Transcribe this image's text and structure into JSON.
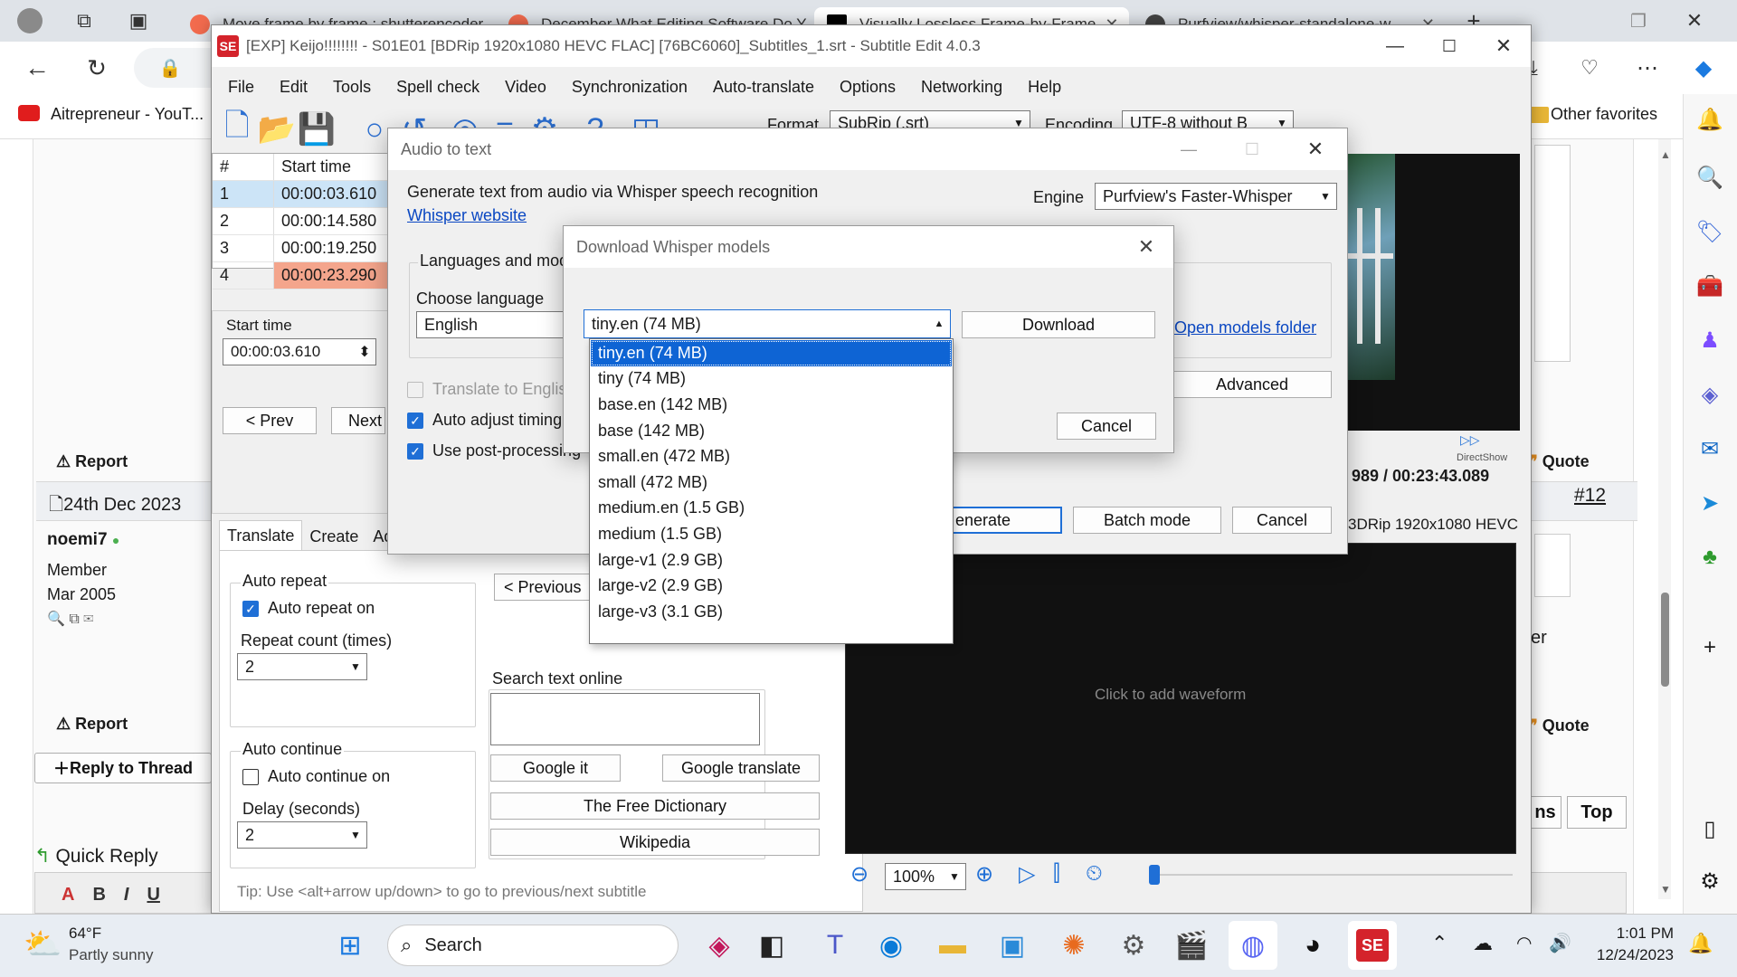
{
  "browser": {
    "tabs": [
      {
        "title": "Move frame by frame : shutterencoder",
        "color": "#f26b4e"
      },
      {
        "title": "December What Editing Software Do Y",
        "color": "#f26b4e"
      },
      {
        "title": "Visually Lossless Frame-by-Frame",
        "color": "#000000"
      },
      {
        "title": "Purfview/whisper-standalone-w",
        "color": "#444444"
      }
    ],
    "favorites": {
      "first": "Aitrepreneur - YouT...",
      "other": "Other favorites"
    }
  },
  "forum": {
    "report1": "Report",
    "date": "24th Dec 2023",
    "username": "noemi7",
    "role": "Member",
    "joined": "Mar 2005",
    "report2": "Report",
    "reply_thread": "Reply to Thread",
    "quick_reply": "Quick Reply",
    "quote1": "Quote",
    "quote2": "Quote",
    "post_num": "#12",
    "partial_er": "er",
    "btn_ns": "ns",
    "btn_top": "Top",
    "editor_btns": [
      "A",
      "B",
      "I",
      "U"
    ]
  },
  "se": {
    "title": "[EXP] Keijo!!!!!!!! - S01E01 [BDRip 1920x1080 HEVC FLAC] [76BC6060]_Subtitles_1.srt - Subtitle Edit 4.0.3",
    "menu": [
      "File",
      "Edit",
      "Tools",
      "Spell check",
      "Video",
      "Synchronization",
      "Auto-translate",
      "Options",
      "Networking",
      "Help"
    ],
    "format_label": "Format",
    "format_value": "SubRip (.srt)",
    "encoding_label": "Encoding",
    "encoding_value": "UTF-8 without B",
    "grid_headers": [
      "#",
      "Start time"
    ],
    "grid_rows": [
      {
        "n": "1",
        "t": "00:00:03.610"
      },
      {
        "n": "2",
        "t": "00:00:14.580"
      },
      {
        "n": "3",
        "t": "00:00:19.250"
      },
      {
        "n": "4",
        "t": "00:00:23.290"
      }
    ],
    "start_time_label": "Start time",
    "start_time_value": "00:00:03.610",
    "prev": "< Prev",
    "next": "Next",
    "tabs": [
      "Translate",
      "Create",
      "Ad"
    ],
    "auto_repeat": "Auto repeat",
    "auto_repeat_on": "Auto repeat on",
    "repeat_count": "Repeat count (times)",
    "repeat_value": "2",
    "auto_continue": "Auto continue",
    "auto_continue_on": "Auto continue on",
    "delay": "Delay (seconds)",
    "delay_value": "2",
    "previous": "< Previous",
    "search_online": "Search text online",
    "google_it": "Google it",
    "google_translate": "Google translate",
    "free_dictionary": "The Free Dictionary",
    "wikipedia": "Wikipedia",
    "tip": "Tip: Use <alt+arrow up/down> to go to previous/next subtitle",
    "video_pos": "989 / 00:23:43.089",
    "video_info": "3DRip 1920x1080 HEVC",
    "directshow": "DirectShow",
    "waveform_hint": "Click to add waveform",
    "zoom": "100%"
  },
  "audio_dialog": {
    "title": "Audio to text",
    "description": "Generate text from audio via Whisper speech recognition",
    "website_link": "Whisper website",
    "engine_label": "Engine",
    "engine_value": "Purfview's Faster-Whisper",
    "lang_group": "Languages and mod",
    "choose_language": "Choose language",
    "language_value": "English",
    "translate_en": "Translate to English",
    "auto_adjust": "Auto adjust timing",
    "post_processing": "Use post-processing",
    "open_models": "Open models folder",
    "advanced": "Advanced",
    "generate": "enerate",
    "batch": "Batch mode",
    "cancel": "Cancel"
  },
  "download_dialog": {
    "title": "Download Whisper models",
    "selected": "tiny.en (74 MB)",
    "download": "Download",
    "cancel": "Cancel",
    "options": [
      "tiny.en (74 MB)",
      "tiny (74 MB)",
      "base.en (142 MB)",
      "base (142 MB)",
      "small.en (472 MB)",
      "small (472 MB)",
      "medium.en (1.5 GB)",
      "medium (1.5 GB)",
      "large-v1 (2.9 GB)",
      "large-v2 (2.9 GB)",
      "large-v3 (3.1 GB)"
    ]
  },
  "taskbar": {
    "temp": "64°F",
    "weather": "Partly sunny",
    "search": "Search",
    "time": "1:01 PM",
    "date": "12/24/2023"
  }
}
